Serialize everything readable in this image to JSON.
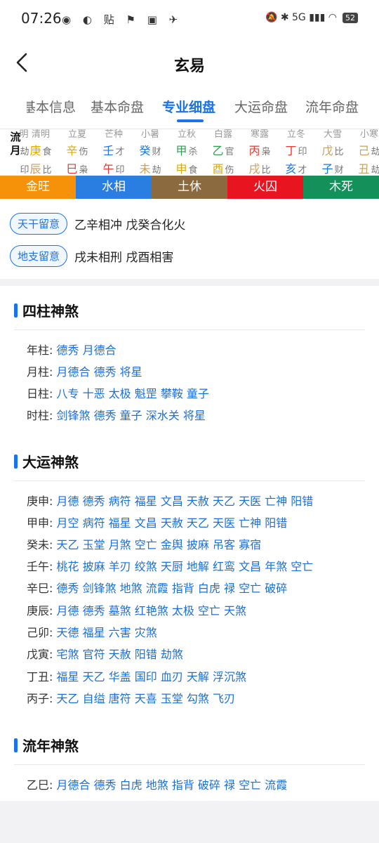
{
  "status": {
    "time": "07:26",
    "left_icons": "◉ ◐ 贴 ⚑ ▣ ✈",
    "right_icons": "🔕 ✱ 5G ▮▮▮ ◠",
    "battery": "52"
  },
  "header": {
    "title": "玄易"
  },
  "tabs": [
    {
      "label": "基本信息",
      "active": false
    },
    {
      "label": "基本命盘",
      "active": false
    },
    {
      "label": "专业细盘",
      "active": true
    },
    {
      "label": "大运命盘",
      "active": false
    },
    {
      "label": "流年命盘",
      "active": false
    }
  ],
  "liunian": {
    "label": "流月",
    "columns": [
      {
        "jieqi": "明",
        "gan": "",
        "gan_shen": "劫",
        "gan_color": "#999999",
        "zhi": "",
        "zhi_shen": "印",
        "zhi_color": "#999999"
      },
      {
        "jieqi": "清明",
        "gan": "庚",
        "gan_shen": "食",
        "gan_color": "#e0a800",
        "zhi": "辰",
        "zhi_shen": "比",
        "zhi_color": "#c8a062"
      },
      {
        "jieqi": "立夏",
        "gan": "辛",
        "gan_shen": "伤",
        "gan_color": "#e0a800",
        "zhi": "巳",
        "zhi_shen": "枭",
        "zhi_color": "#e53935"
      },
      {
        "jieqi": "芒种",
        "gan": "壬",
        "gan_shen": "才",
        "gan_color": "#1a73e8",
        "zhi": "午",
        "zhi_shen": "印",
        "zhi_color": "#e53935"
      },
      {
        "jieqi": "小暑",
        "gan": "癸",
        "gan_shen": "财",
        "gan_color": "#1a73e8",
        "zhi": "未",
        "zhi_shen": "劫",
        "zhi_color": "#c8a062"
      },
      {
        "jieqi": "立秋",
        "gan": "甲",
        "gan_shen": "杀",
        "gan_color": "#2e9e4f",
        "zhi": "申",
        "zhi_shen": "食",
        "zhi_color": "#e0a800"
      },
      {
        "jieqi": "白露",
        "gan": "乙",
        "gan_shen": "官",
        "gan_color": "#2e9e4f",
        "zhi": "酉",
        "zhi_shen": "伤",
        "zhi_color": "#e0a800"
      },
      {
        "jieqi": "寒露",
        "gan": "丙",
        "gan_shen": "枭",
        "gan_color": "#e53935",
        "zhi": "戌",
        "zhi_shen": "比",
        "zhi_color": "#c8a062"
      },
      {
        "jieqi": "立冬",
        "gan": "丁",
        "gan_shen": "印",
        "gan_color": "#e53935",
        "zhi": "亥",
        "zhi_shen": "才",
        "zhi_color": "#1a73e8"
      },
      {
        "jieqi": "大雪",
        "gan": "戊",
        "gan_shen": "比",
        "gan_color": "#c8a062",
        "zhi": "子",
        "zhi_shen": "财",
        "zhi_color": "#1a73e8"
      },
      {
        "jieqi": "小寒",
        "gan": "己",
        "gan_shen": "劫",
        "gan_color": "#c8a062",
        "zhi": "丑",
        "zhi_shen": "劫",
        "zhi_color": "#c8a062"
      }
    ]
  },
  "wuxing": [
    {
      "label": "金旺",
      "color": "#f5920a"
    },
    {
      "label": "水相",
      "color": "#2a7de1"
    },
    {
      "label": "土休",
      "color": "#8c6a3f"
    },
    {
      "label": "火囚",
      "color": "#e8141f"
    },
    {
      "label": "木死",
      "color": "#14915a"
    }
  ],
  "notices": [
    {
      "tag": "天干留意",
      "text": "乙辛相冲 戊癸合化火"
    },
    {
      "tag": "地支留意",
      "text": "戌未相刑 戌酉相害"
    }
  ],
  "sections": {
    "sizhu": {
      "title": "四柱神煞",
      "rows": [
        {
          "key": "年柱:",
          "value": "德秀 月德合"
        },
        {
          "key": "月柱:",
          "value": "月德合 德秀 将星"
        },
        {
          "key": "日柱:",
          "value": "八专 十恶 太极 魁罡 攀鞍 童子"
        },
        {
          "key": "时柱:",
          "value": "剑锋煞 德秀 童子 深水关 将星"
        }
      ]
    },
    "dayun": {
      "title": "大运神煞",
      "rows": [
        {
          "key": "庚申:",
          "value": "月德 德秀 病符 福星 文昌 天赦 天乙 天医 亡神 阳错"
        },
        {
          "key": "甲申:",
          "value": "月空 病符 福星 文昌 天赦 天乙 天医 亡神 阳错"
        },
        {
          "key": "癸未:",
          "value": "天乙 玉堂 月煞 空亡 金舆 披麻 吊客 寡宿"
        },
        {
          "key": "壬午:",
          "value": "桃花 披麻 羊刃 绞煞 天厨 地解 红鸾 文昌 年煞 空亡"
        },
        {
          "key": "辛巳:",
          "value": "德秀 剑锋煞 地煞 流霞 指背 白虎 禄 空亡 破碎"
        },
        {
          "key": "庚辰:",
          "value": "月德 德秀 墓煞 红艳煞 太极 空亡 天煞"
        },
        {
          "key": "己卯:",
          "value": "天德 福星 六害 灾煞"
        },
        {
          "key": "戊寅:",
          "value": "宅煞 官符 天赦 阳错 劫煞"
        },
        {
          "key": "丁丑:",
          "value": "福星 天乙 华盖 国印 血刃 天解 浮沉煞"
        },
        {
          "key": "丙子:",
          "value": "天乙 自缢 唐符 天喜 玉堂 勾煞 飞刃"
        }
      ]
    },
    "liunian_shensha": {
      "title": "流年神煞",
      "rows": [
        {
          "key": "乙巳:",
          "value": "月德合 德秀 白虎 地煞 指背 破碎 禄 空亡 流霞"
        }
      ]
    }
  }
}
